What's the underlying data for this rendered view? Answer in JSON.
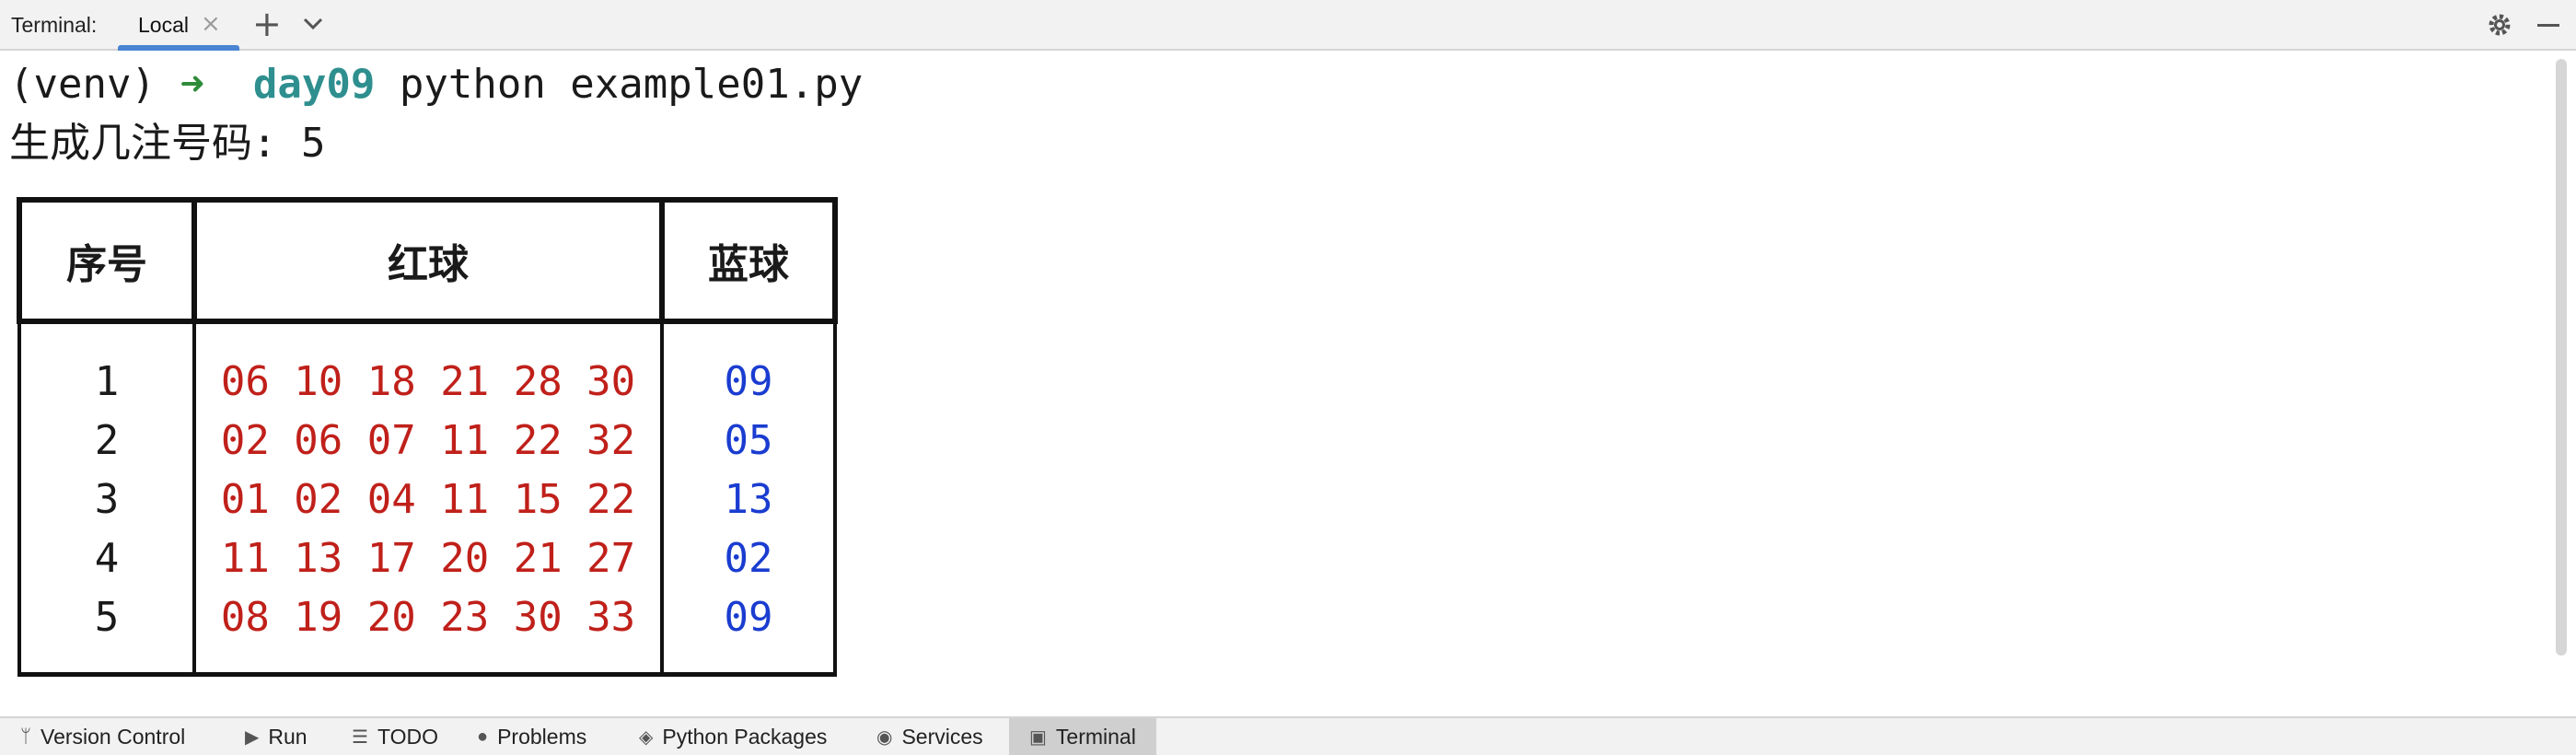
{
  "toolbar": {
    "label": "Terminal:",
    "tab_label": "Local",
    "close_glyph": "×",
    "plus_glyph": "+",
    "icons": [
      "chevron-down-icon",
      "gear-icon",
      "minimize-icon"
    ]
  },
  "terminal": {
    "prompt_venv": "(venv) ",
    "prompt_arrow": "➜",
    "prompt_dir": "day09",
    "command": " python example01.py",
    "prompt_line2": "生成几注号码: 5"
  },
  "table": {
    "headers": [
      "序号",
      "红球",
      "蓝球"
    ],
    "rows": [
      {
        "index": "1",
        "red": "06 10 18 21 28 30",
        "blue": "09"
      },
      {
        "index": "2",
        "red": "02 06 07 11 22 32",
        "blue": "05"
      },
      {
        "index": "3",
        "red": "01 02 04 11 15 22",
        "blue": "13"
      },
      {
        "index": "4",
        "red": "11 13 17 20 21 27",
        "blue": "02"
      },
      {
        "index": "5",
        "red": "08 19 20 23 30 33",
        "blue": "09"
      }
    ]
  },
  "bottom_bar": {
    "items": [
      {
        "label": "Version Control",
        "icon": "branch-icon"
      },
      {
        "label": "Run",
        "icon": "play-icon"
      },
      {
        "label": "TODO",
        "icon": "list-icon"
      },
      {
        "label": "Problems",
        "icon": "problems-icon"
      },
      {
        "label": "Python Packages",
        "icon": "layers-icon"
      },
      {
        "label": "Services",
        "icon": "services-icon"
      },
      {
        "label": "Terminal",
        "icon": "terminal-icon"
      }
    ],
    "active": "Terminal"
  },
  "colors": {
    "red_balls": "#c0201a",
    "blue_balls": "#1a3cd0",
    "prompt_arrow": "#2e8b3a",
    "prompt_dir": "#2f8f8f",
    "tab_underline": "#4a84d3"
  }
}
